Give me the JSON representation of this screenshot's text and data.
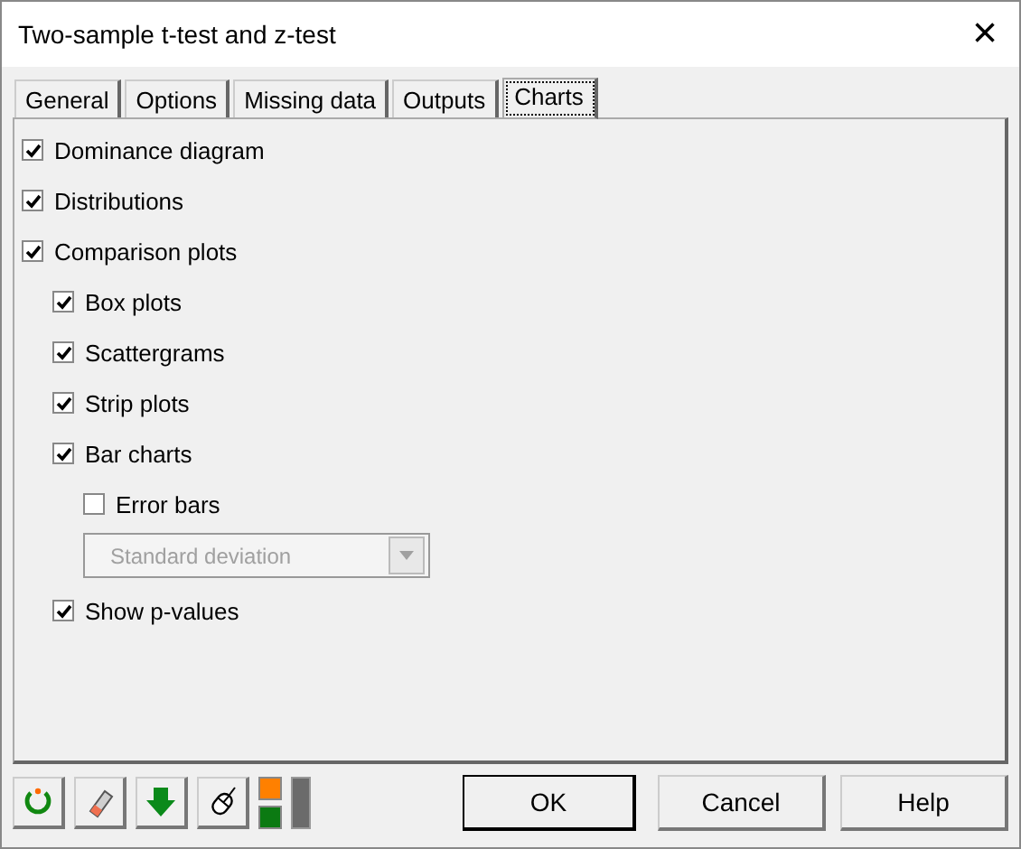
{
  "window": {
    "title": "Two-sample t-test and z-test",
    "close": "×"
  },
  "tabs": [
    {
      "label": "General",
      "selected": false
    },
    {
      "label": "Options",
      "selected": false
    },
    {
      "label": "Missing data",
      "selected": false
    },
    {
      "label": "Outputs",
      "selected": false
    },
    {
      "label": "Charts",
      "selected": true
    }
  ],
  "options": [
    {
      "kind": "checkbox",
      "label": "Dominance diagram",
      "checked": true
    },
    {
      "kind": "checkbox",
      "label": "Distributions",
      "checked": true
    },
    {
      "kind": "checkbox",
      "label": "Comparison plots",
      "checked": true,
      "children": [
        {
          "kind": "checkbox",
          "label": "Box plots",
          "checked": true
        },
        {
          "kind": "checkbox",
          "label": "Scattergrams",
          "checked": true
        },
        {
          "kind": "checkbox",
          "label": "Strip plots",
          "checked": true
        },
        {
          "kind": "checkbox",
          "label": "Bar charts",
          "checked": true,
          "children": [
            {
              "kind": "checkbox",
              "label": "Error bars",
              "checked": false
            },
            {
              "kind": "dropdown",
              "value": "Standard deviation",
              "disabled": true
            }
          ]
        },
        {
          "kind": "checkbox",
          "label": "Show p-values",
          "checked": true
        }
      ]
    }
  ],
  "buttons": [
    "OK",
    "Cancel",
    "Help"
  ]
}
